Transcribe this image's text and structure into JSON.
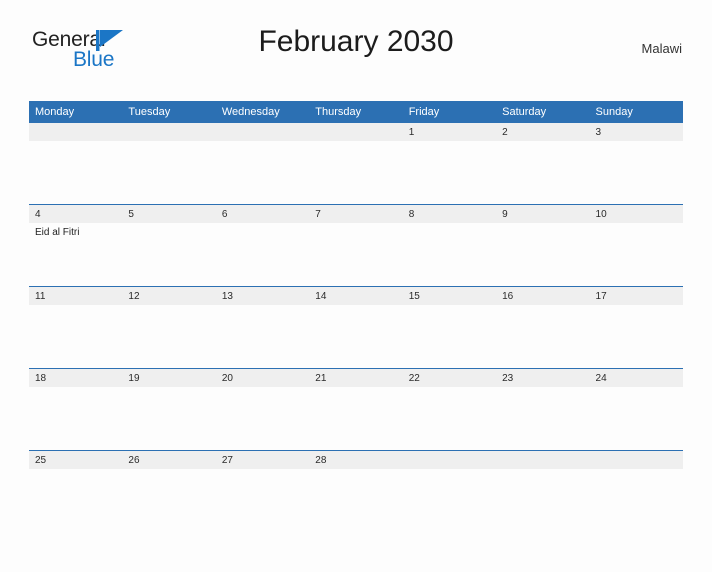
{
  "brand": {
    "word1": "General",
    "word2": "Blue",
    "flag_icon": "blue-triangle-flag-icon",
    "color_text": "#222222",
    "color_blue": "#1b76c6"
  },
  "header": {
    "title": "February 2030",
    "country": "Malawi"
  },
  "theme": {
    "header_blue": "#2c70b3",
    "daynum_band": "#efefef",
    "page_background": "#fdfdfd",
    "text": "#1c1c1c"
  },
  "calendar": {
    "weekday_headers": [
      "Monday",
      "Tuesday",
      "Wednesday",
      "Thursday",
      "Friday",
      "Saturday",
      "Sunday"
    ],
    "weeks": [
      [
        {
          "day": "",
          "events": []
        },
        {
          "day": "",
          "events": []
        },
        {
          "day": "",
          "events": []
        },
        {
          "day": "",
          "events": []
        },
        {
          "day": "1",
          "events": []
        },
        {
          "day": "2",
          "events": []
        },
        {
          "day": "3",
          "events": []
        }
      ],
      [
        {
          "day": "4",
          "events": [
            "Eid al Fitri"
          ]
        },
        {
          "day": "5",
          "events": []
        },
        {
          "day": "6",
          "events": []
        },
        {
          "day": "7",
          "events": []
        },
        {
          "day": "8",
          "events": []
        },
        {
          "day": "9",
          "events": []
        },
        {
          "day": "10",
          "events": []
        }
      ],
      [
        {
          "day": "11",
          "events": []
        },
        {
          "day": "12",
          "events": []
        },
        {
          "day": "13",
          "events": []
        },
        {
          "day": "14",
          "events": []
        },
        {
          "day": "15",
          "events": []
        },
        {
          "day": "16",
          "events": []
        },
        {
          "day": "17",
          "events": []
        }
      ],
      [
        {
          "day": "18",
          "events": []
        },
        {
          "day": "19",
          "events": []
        },
        {
          "day": "20",
          "events": []
        },
        {
          "day": "21",
          "events": []
        },
        {
          "day": "22",
          "events": []
        },
        {
          "day": "23",
          "events": []
        },
        {
          "day": "24",
          "events": []
        }
      ],
      [
        {
          "day": "25",
          "events": []
        },
        {
          "day": "26",
          "events": []
        },
        {
          "day": "27",
          "events": []
        },
        {
          "day": "28",
          "events": []
        },
        {
          "day": "",
          "events": []
        },
        {
          "day": "",
          "events": []
        },
        {
          "day": "",
          "events": []
        }
      ]
    ]
  }
}
